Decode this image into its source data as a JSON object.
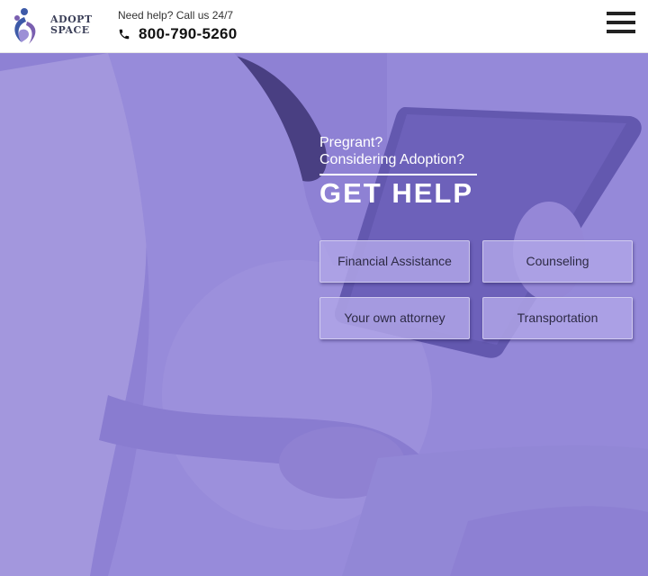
{
  "header": {
    "logo": {
      "line1": "ADOPT",
      "line2": "SPACE"
    },
    "help_text": "Need help? Call us 24/7",
    "phone_number": "800-790-5260",
    "menu_icon": "hamburger-menu-icon",
    "phone_icon": "phone-icon"
  },
  "hero": {
    "pre_title_line1": "Pregrant?",
    "pre_title_line2": "Considering Adoption?",
    "title": "GET HELP",
    "options": [
      {
        "label": "Financial Assistance"
      },
      {
        "label": "Counseling"
      },
      {
        "label": "Your own attorney"
      },
      {
        "label": "Transportation"
      }
    ]
  },
  "colors": {
    "overlay": "#8f83d2",
    "button_bg": "#afa5e6",
    "header_bg": "#ffffff",
    "logo_blue": "#3d5aa8",
    "logo_purple": "#7a5fb0"
  }
}
